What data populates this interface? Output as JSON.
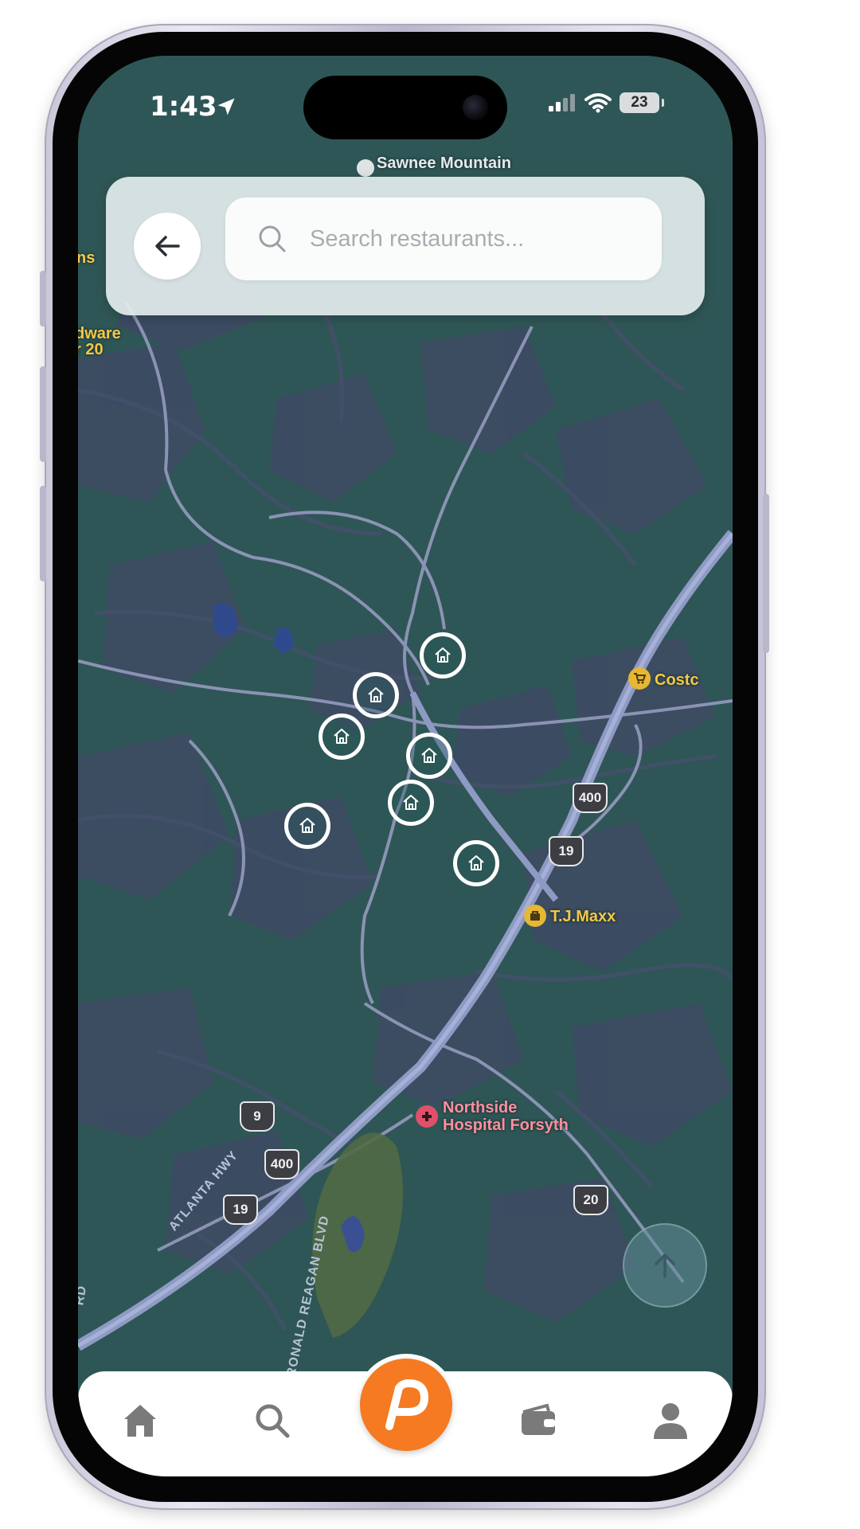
{
  "status_bar": {
    "time": "1:43",
    "battery": "23"
  },
  "search": {
    "placeholder": "Search restaurants..."
  },
  "map": {
    "labels": {
      "sawnee": "Sawnee Mountain",
      "costco": "Costc",
      "tjmaxx": "T.J.Maxx",
      "hospital_line1": "Northside",
      "hospital_line2": "Hospital Forsyth",
      "hardware_line1": "dware",
      "hardware_line2": "r 20",
      "left_edge": "ns"
    },
    "road_names": {
      "atlanta_hwy": "ATLANTA HWY",
      "reagan_blvd": "RONALD REAGAN BLVD",
      "edge": "RD"
    },
    "shields": {
      "s400_top": "400",
      "s19_top": "19",
      "s9": "9",
      "s400_bottom": "400",
      "s19_bottom": "19",
      "s20": "20"
    },
    "marker_icon": "home-icon",
    "marker_count": 7
  },
  "tabs": [
    {
      "name": "home",
      "icon": "home-icon"
    },
    {
      "name": "search",
      "icon": "search-icon"
    },
    {
      "name": "center",
      "icon": "p-logo-icon"
    },
    {
      "name": "wallet",
      "icon": "wallet-icon"
    },
    {
      "name": "profile",
      "icon": "person-icon"
    }
  ],
  "colors": {
    "map_base": "#2f5656",
    "accent": "#f57a21",
    "marker": "#ffffff",
    "tab_icon": "#7a7a7a"
  }
}
